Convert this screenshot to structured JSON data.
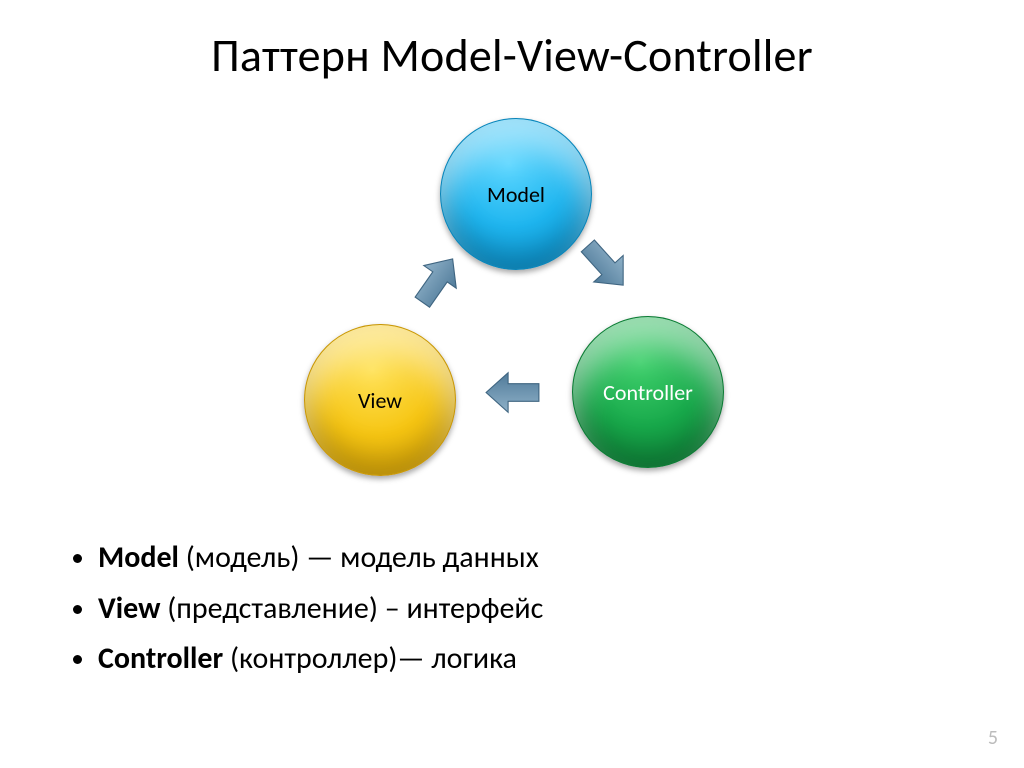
{
  "title": "Паттерн Model-View-Controller",
  "diagram": {
    "nodes": {
      "model": "Model",
      "controller": "Controller",
      "view": "View"
    },
    "arrow_color": "#5f88a8",
    "arrows": [
      "model→controller",
      "controller→view",
      "view→model"
    ]
  },
  "bullets": [
    {
      "term": "Model",
      "trans": " (модель) — модель данных"
    },
    {
      "term": "View",
      "trans": " (представление) – интерфейс"
    },
    {
      "term": "Controller",
      "trans": " (контроллер)— логика"
    }
  ],
  "page_number": "5"
}
